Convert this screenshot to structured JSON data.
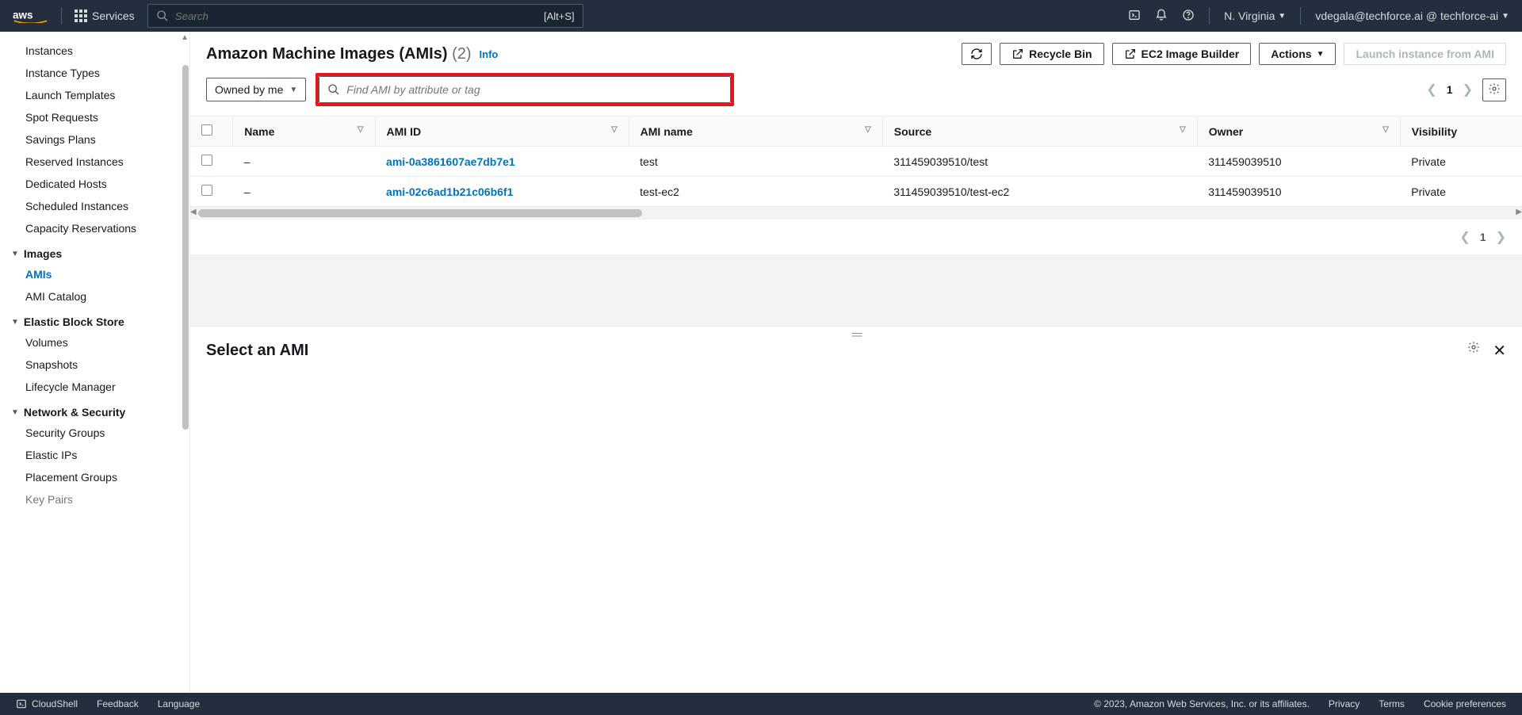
{
  "topbar": {
    "services_label": "Services",
    "search_placeholder": "Search",
    "search_shortcut": "[Alt+S]",
    "region": "N. Virginia",
    "account": "vdegala@techforce.ai @ techforce-ai"
  },
  "sidebar": {
    "items_top": [
      "Instances",
      "Instance Types",
      "Launch Templates",
      "Spot Requests",
      "Savings Plans",
      "Reserved Instances",
      "Dedicated Hosts",
      "Scheduled Instances",
      "Capacity Reservations"
    ],
    "sections": [
      {
        "title": "Images",
        "items": [
          "AMIs",
          "AMI Catalog"
        ],
        "active_index": 0
      },
      {
        "title": "Elastic Block Store",
        "items": [
          "Volumes",
          "Snapshots",
          "Lifecycle Manager"
        ]
      },
      {
        "title": "Network & Security",
        "items": [
          "Security Groups",
          "Elastic IPs",
          "Placement Groups",
          "Key Pairs"
        ]
      }
    ]
  },
  "header": {
    "title": "Amazon Machine Images (AMIs)",
    "count": "(2)",
    "info": "Info",
    "recycle_bin": "Recycle Bin",
    "image_builder": "EC2 Image Builder",
    "actions": "Actions",
    "launch": "Launch instance from AMI"
  },
  "filter": {
    "owned_label": "Owned by me",
    "search_placeholder": "Find AMI by attribute or tag",
    "page": "1"
  },
  "table": {
    "columns": [
      "Name",
      "AMI ID",
      "AMI name",
      "Source",
      "Owner",
      "Visibility"
    ],
    "rows": [
      {
        "name": "–",
        "ami_id": "ami-0a3861607ae7db7e1",
        "ami_name": "test",
        "source": "311459039510/test",
        "owner": "311459039510",
        "visibility": "Private"
      },
      {
        "name": "–",
        "ami_id": "ami-02c6ad1b21c06b6f1",
        "ami_name": "test-ec2",
        "source": "311459039510/test-ec2",
        "owner": "311459039510",
        "visibility": "Private"
      }
    ]
  },
  "pager_bottom": {
    "page": "1"
  },
  "detail": {
    "title": "Select an AMI"
  },
  "footer": {
    "cloudshell": "CloudShell",
    "feedback": "Feedback",
    "language": "Language",
    "copyright": "© 2023, Amazon Web Services, Inc. or its affiliates.",
    "privacy": "Privacy",
    "terms": "Terms",
    "cookies": "Cookie preferences"
  }
}
